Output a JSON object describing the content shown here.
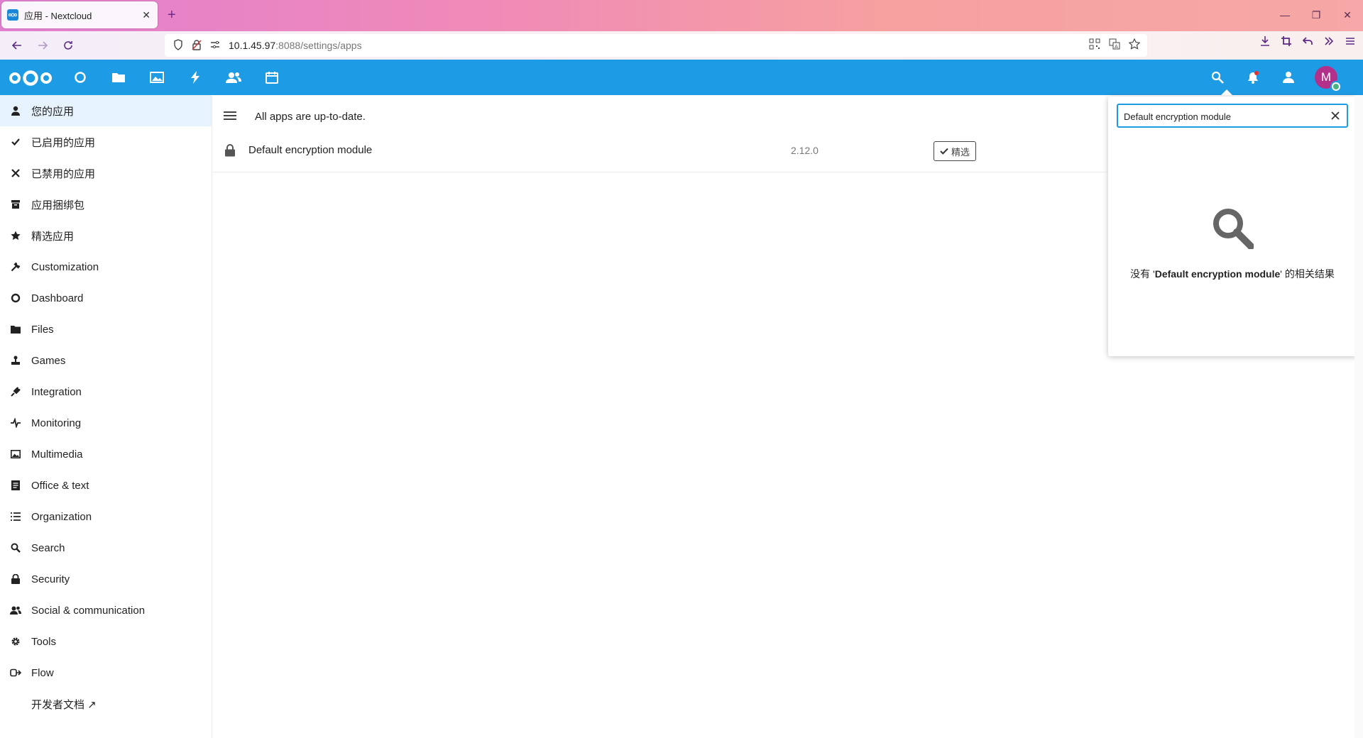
{
  "browser": {
    "tab_title": "应用 - Nextcloud",
    "tab_close": "✕",
    "new_tab": "+",
    "url_host": "10.1.45.97",
    "url_path": ":8088/settings/apps",
    "window_controls": [
      "—",
      "❐",
      "✕"
    ]
  },
  "header": {
    "apps": [
      "dashboard-icon",
      "files-icon",
      "photos-icon",
      "activity-icon",
      "contacts-icon",
      "calendar-icon"
    ],
    "avatar_initial": "M"
  },
  "sidebar": {
    "items": [
      {
        "label": "您的应用",
        "icon": "user-icon"
      },
      {
        "label": "已启用的应用",
        "icon": "check-icon"
      },
      {
        "label": "已禁用的应用",
        "icon": "close-icon"
      },
      {
        "label": "应用捆绑包",
        "icon": "archive-icon"
      },
      {
        "label": "精选应用",
        "icon": "star-icon"
      },
      {
        "label": "Customization",
        "icon": "wrench-icon"
      },
      {
        "label": "Dashboard",
        "icon": "circle-icon"
      },
      {
        "label": "Files",
        "icon": "folder-icon"
      },
      {
        "label": "Games",
        "icon": "joystick-icon"
      },
      {
        "label": "Integration",
        "icon": "plug-icon"
      },
      {
        "label": "Monitoring",
        "icon": "pulse-icon"
      },
      {
        "label": "Multimedia",
        "icon": "image-icon"
      },
      {
        "label": "Office & text",
        "icon": "document-icon"
      },
      {
        "label": "Organization",
        "icon": "list-icon"
      },
      {
        "label": "Search",
        "icon": "search-icon"
      },
      {
        "label": "Security",
        "icon": "lock-icon"
      },
      {
        "label": "Social & communication",
        "icon": "people-icon"
      },
      {
        "label": "Tools",
        "icon": "gear-icon"
      },
      {
        "label": "Flow",
        "icon": "flow-icon"
      },
      {
        "label": "开发者文档 ↗",
        "icon": ""
      }
    ]
  },
  "main": {
    "status": "All apps are up-to-date.",
    "app": {
      "name": "Default encryption module",
      "version": "2.12.0",
      "badge": "精选"
    }
  },
  "search": {
    "query": "Default encryption module",
    "empty_prefix": "没有 '",
    "empty_term": "Default encryption module",
    "empty_suffix": "' 的相关结果"
  },
  "colors": {
    "brand": "#1e9be5",
    "active_bg": "#e6f3fc",
    "avatar": "#b3308a",
    "status_online": "#49b382"
  }
}
